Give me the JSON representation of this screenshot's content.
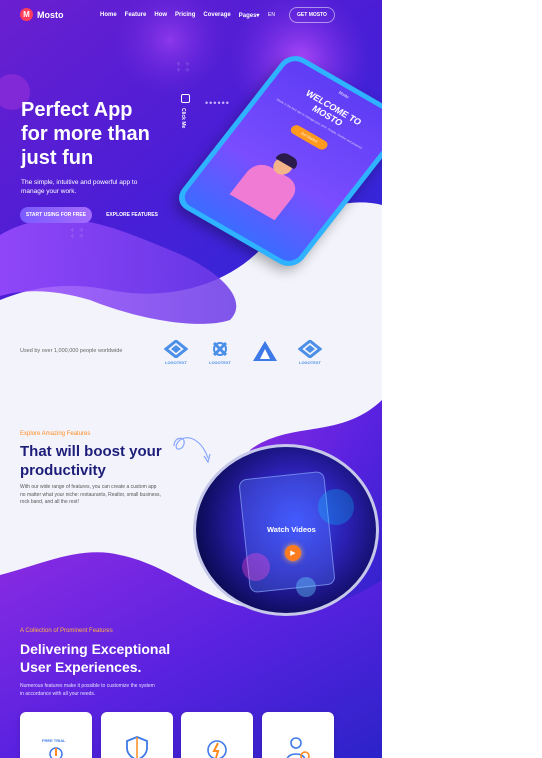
{
  "header": {
    "logo_letter": "M",
    "brand": "Mosto",
    "nav": [
      "Home",
      "Feature",
      "How",
      "Pricing",
      "Coverage",
      "Pages"
    ],
    "lang": "EN",
    "cta": "GET MOSTO"
  },
  "hero": {
    "title_lines": [
      "Perfect App",
      "for more than",
      "just fun"
    ],
    "subtitle_lines": [
      "The simple, intuitive and powerful app to",
      "manage your work."
    ],
    "primary_button": "START USING FOR FREE",
    "secondary_button": "EXPLORE FEATURES",
    "click_me": "Click Me"
  },
  "phone": {
    "app_name": "Mosto",
    "welcome_lines": [
      "WELCOME TO",
      "MOSTO"
    ],
    "text": "Mosto is the best app to manage your work. Simple, intuitive and powerful.",
    "button": "Get Started"
  },
  "logos": {
    "used_by": "Used by over 1,000,000 people worldwide",
    "items": [
      "LOGOTEXT",
      "LOGOTEXT",
      "",
      "LOGOTEXT"
    ]
  },
  "features": {
    "label": "Explore Amazing Features",
    "title_lines": [
      "That will boost your",
      "productivity"
    ],
    "text_lines": [
      "With our wide range of features, you can create a custom app",
      "no matter what your niche: restaurants, Realtor, small business,",
      "rock band, and all the rest!"
    ],
    "video_label": "Watch Videos"
  },
  "collection": {
    "label": "A Collection of Prominent Features",
    "title_lines": [
      "Delivering Exceptional",
      "User Experiences."
    ],
    "text_lines": [
      "Numerous features make it possible to customize the system",
      "in accordance with all your needs."
    ],
    "card_1_label": "FREE TRIAL"
  },
  "colors": {
    "primary_purple": "#4a1fd6",
    "accent_orange": "#ff8a1f",
    "brand_red": "#ff3d5a",
    "heading_navy": "#1d1d7a"
  }
}
